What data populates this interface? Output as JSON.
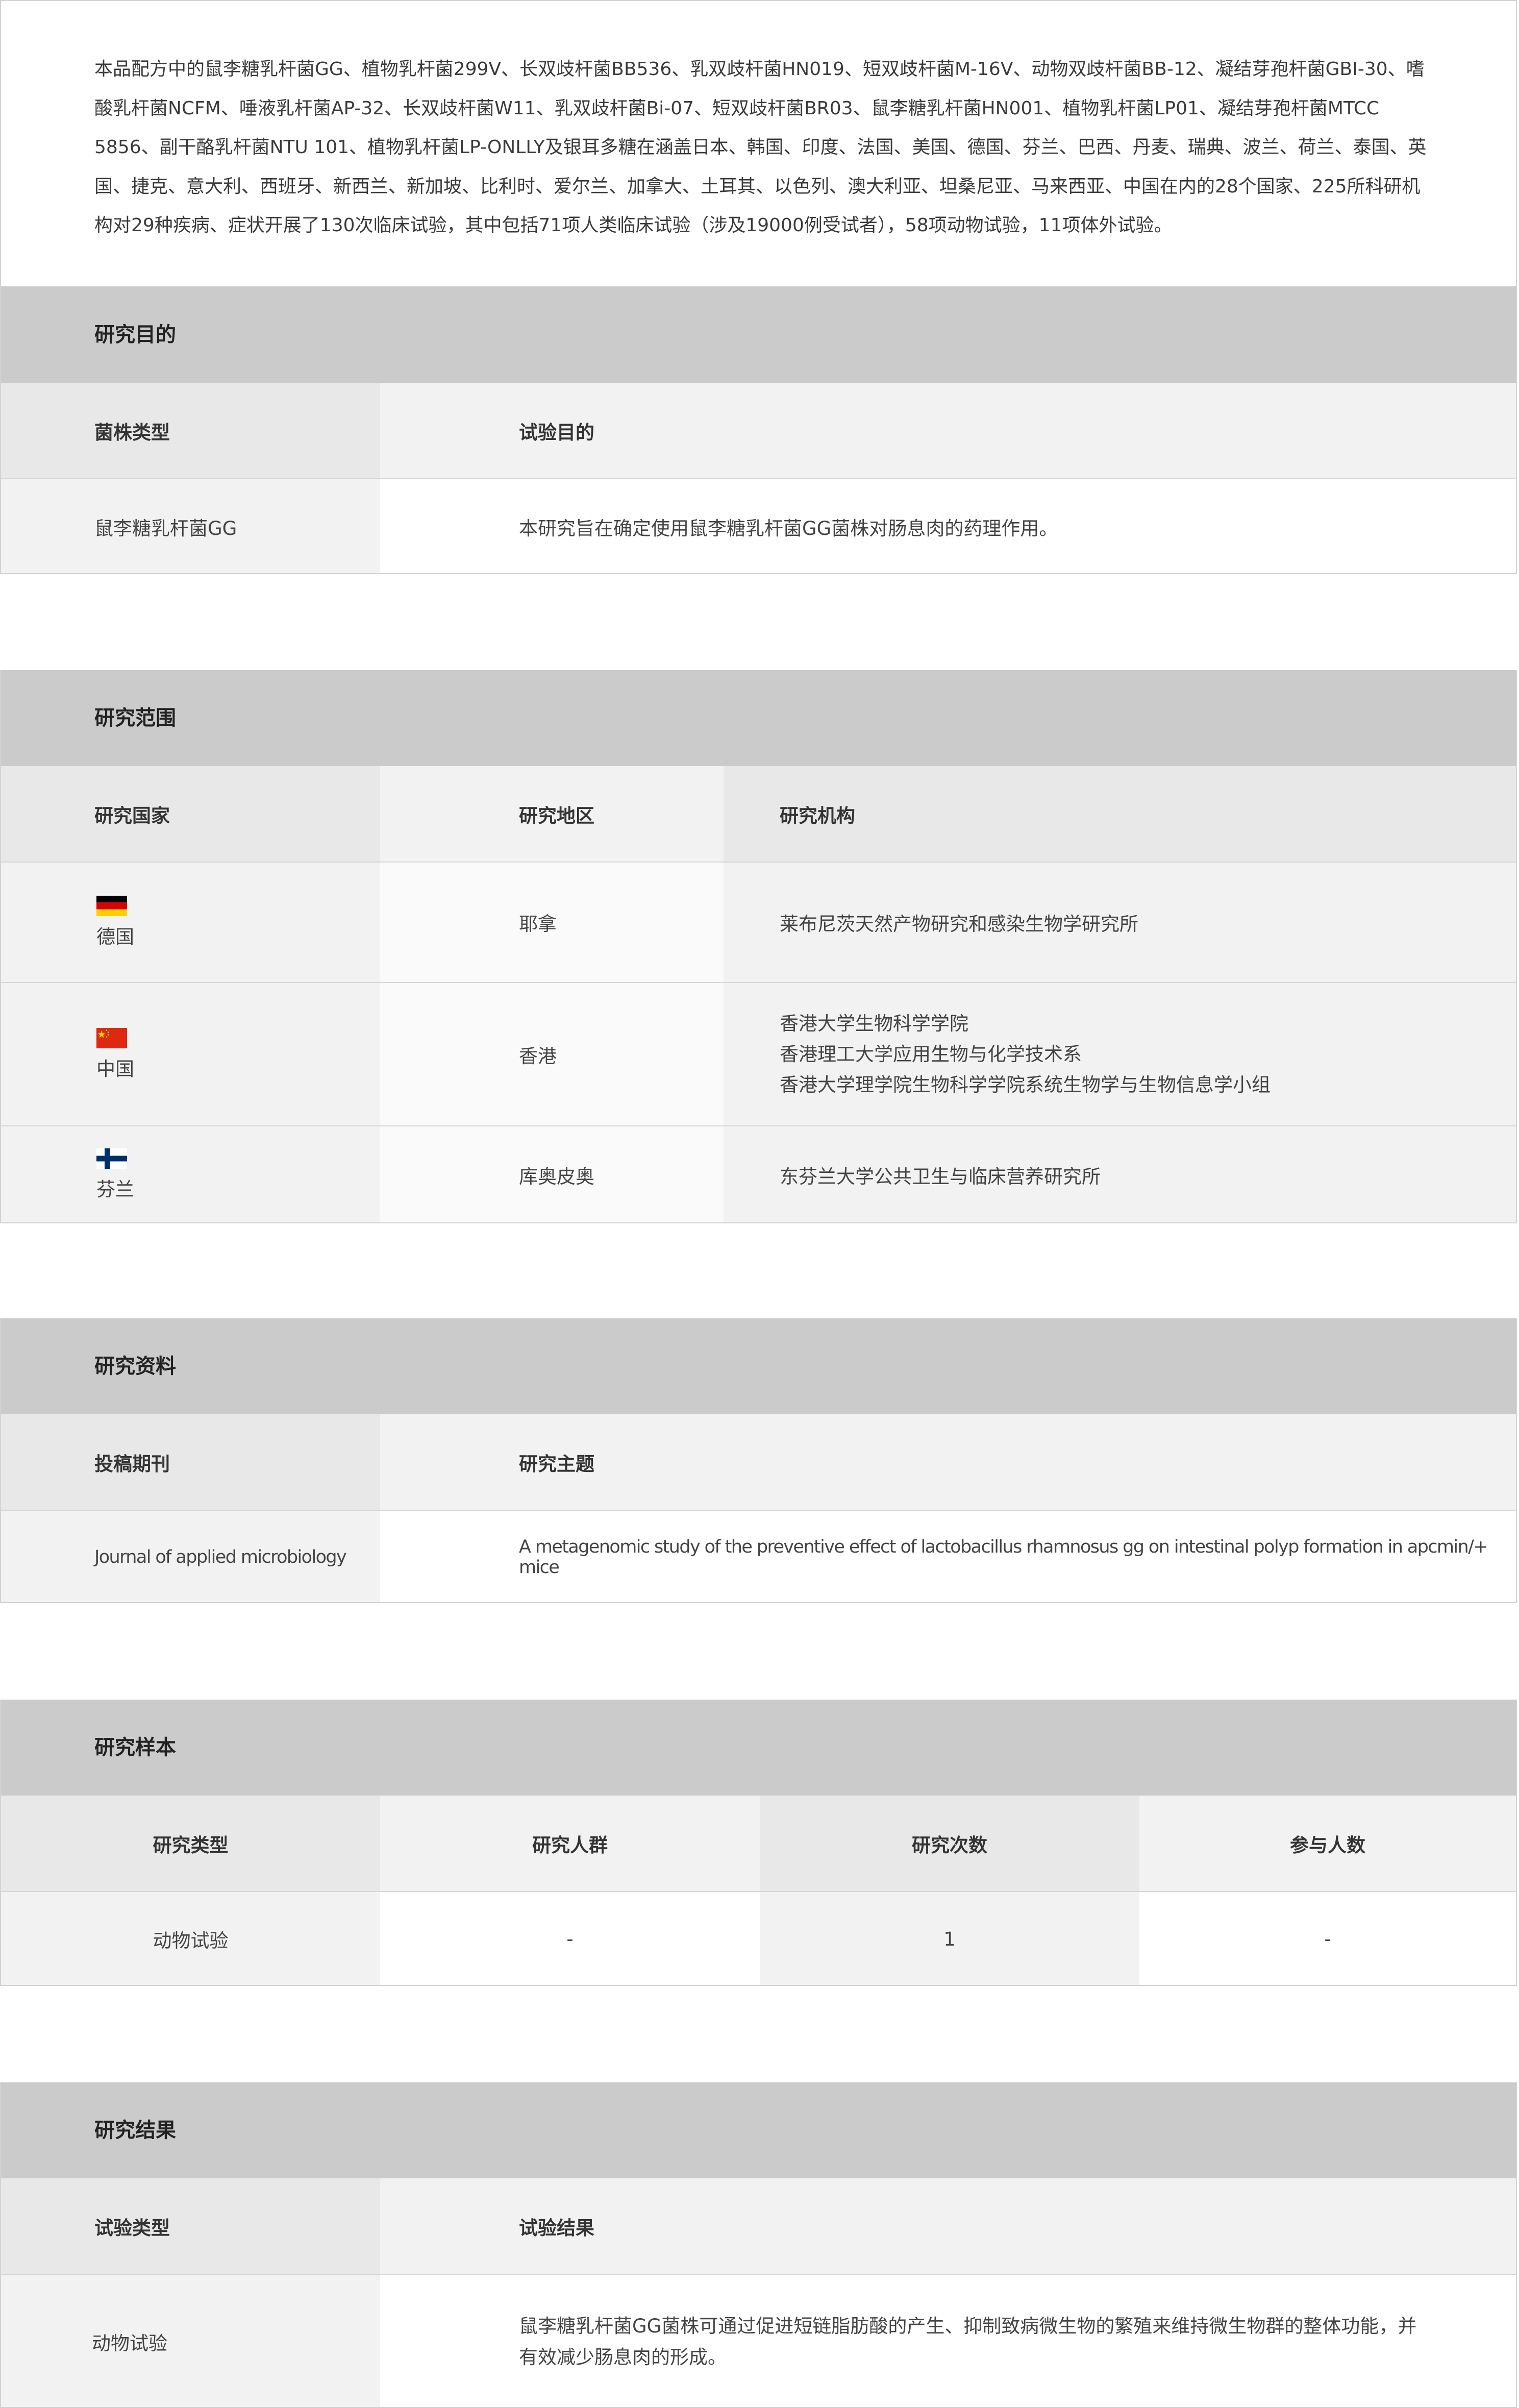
{
  "intro": {
    "text": "本品配方中的鼠李糖乳杆菌GG、植物乳杆菌299V、长双歧杆菌BB536、乳双歧杆菌HN019、短双歧杆菌M-16V、动物双歧杆菌BB-12、凝结芽孢杆菌GBI-30、嗜酸乳杆菌NCFM、唾液乳杆菌AP-32、长双歧杆菌W11、乳双歧杆菌Bi-07、短双歧杆菌BR03、鼠李糖乳杆菌HN001、植物乳杆菌LP01、凝结芽孢杆菌MTCC 5856、副干酪乳杆菌NTU 101、植物乳杆菌LP-ONLLY及银耳多糖在涵盖日本、韩国、印度、法国、美国、德国、芬兰、巴西、丹麦、瑞典、波兰、荷兰、泰国、英国、捷克、意大利、西班牙、新西兰、新加坡、比利时、爱尔兰、加拿大、土耳其、以色列、澳大利亚、坦桑尼亚、马来西亚、中国在内的28个国家、225所科研机构对29种疾病、症状开展了130次临床试验，其中包括71项人类临床试验（涉及19000例受试者），58项动物试验，11项体外试验。"
  },
  "purpose": {
    "title": "研究目的",
    "headers": [
      "菌株类型",
      "试验目的"
    ],
    "rows": [
      [
        "鼠李糖乳杆菌GG",
        "本研究旨在确定使用鼠李糖乳杆菌GG菌株对肠息肉的药理作用。"
      ]
    ]
  },
  "scope": {
    "title": "研究范围",
    "headers": [
      "研究国家",
      "研究地区",
      "研究机构"
    ],
    "rows": [
      {
        "country": "德国",
        "flag": "germany-flag-icon",
        "region": "耶拿",
        "institutions": [
          "莱布尼茨天然产物研究和感染生物学研究所"
        ]
      },
      {
        "country": "中国",
        "flag": "china-flag-icon",
        "region": "香港",
        "institutions": [
          "香港大学生物科学学院",
          "香港理工大学应用生物与化学技术系",
          "香港大学理学院生物科学学院系统生物学与生物信息学小组"
        ]
      },
      {
        "country": "芬兰",
        "flag": "finland-flag-icon",
        "region": "库奥皮奥",
        "institutions": [
          "东芬兰大学公共卫生与临床营养研究所"
        ]
      }
    ]
  },
  "materials": {
    "title": "研究资料",
    "headers": [
      "投稿期刊",
      "研究主题"
    ],
    "rows": [
      [
        "Journal of applied microbiology",
        "A metagenomic study of the preventive effect of lactobacillus rhamnosus gg on intestinal polyp formation in apcmin/+ mice"
      ]
    ]
  },
  "sample": {
    "title": "研究样本",
    "headers": [
      "研究类型",
      "研究人群",
      "研究次数",
      "参与人数"
    ],
    "rows": [
      [
        "动物试验",
        "-",
        "1",
        "-"
      ]
    ]
  },
  "results": {
    "title": "研究结果",
    "headers": [
      "试验类型",
      "试验结果"
    ],
    "rows": [
      [
        "动物试验",
        "鼠李糖乳杆菌GG菌株可通过促进短链脂肪酸的产生、抑制致病微生物的繁殖来维持微生物群的整体功能，并有效减少肠息肉的形成。"
      ]
    ]
  },
  "colors": {
    "title_bar": "#cbcbcb",
    "header_dark": "#e8e8e8",
    "header_light": "#f2f2f2",
    "border": "#d2d2d2",
    "text": "#333333"
  }
}
